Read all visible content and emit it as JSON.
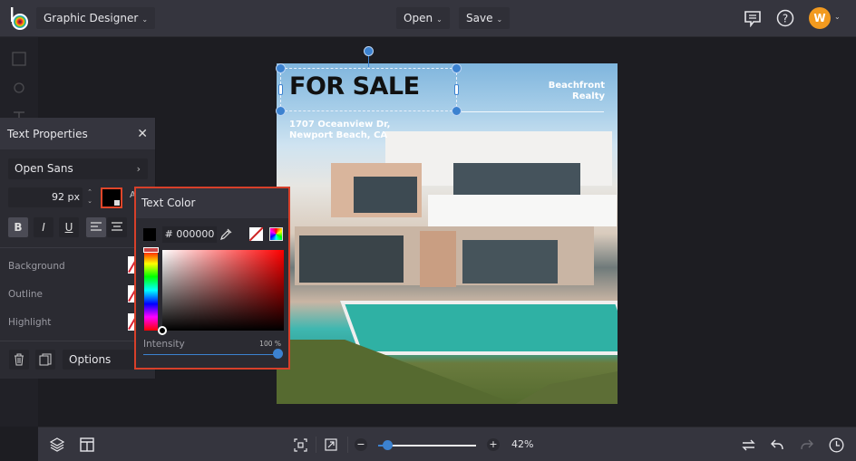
{
  "topbar": {
    "logo": "befunky-logo",
    "doc_type": "Graphic Designer",
    "open_label": "Open",
    "save_label": "Save",
    "icons": [
      "chat-icon",
      "help-icon"
    ],
    "avatar_initial": "W"
  },
  "text_properties": {
    "title": "Text Properties",
    "font": "Open Sans",
    "font_size": "92",
    "font_size_unit": "px",
    "text_color": "#000000",
    "format_buttons": [
      "B",
      "I",
      "U"
    ],
    "alignment": "left",
    "rows": [
      {
        "label": "Background"
      },
      {
        "label": "Outline"
      },
      {
        "label": "Highlight"
      }
    ],
    "options_label": "Options"
  },
  "text_color_popover": {
    "title": "Text Color",
    "hex_prefix": "#",
    "hex_value": "000000",
    "intensity_label": "Intensity",
    "intensity_value": "100 %",
    "intensity_percent": 100,
    "accent": "#3c82d0",
    "highlight_border": "#d7402a"
  },
  "poster": {
    "title": "FOR SALE",
    "address_line1": "1707 Oceanview Dr,",
    "address_line2": "Newport Beach, CA",
    "brand_line1": "Beachfront",
    "brand_line2": "Realty"
  },
  "bottombar": {
    "zoom_value": "42%",
    "zoom_out": "−",
    "zoom_in": "+",
    "zoom_percent": 42
  }
}
